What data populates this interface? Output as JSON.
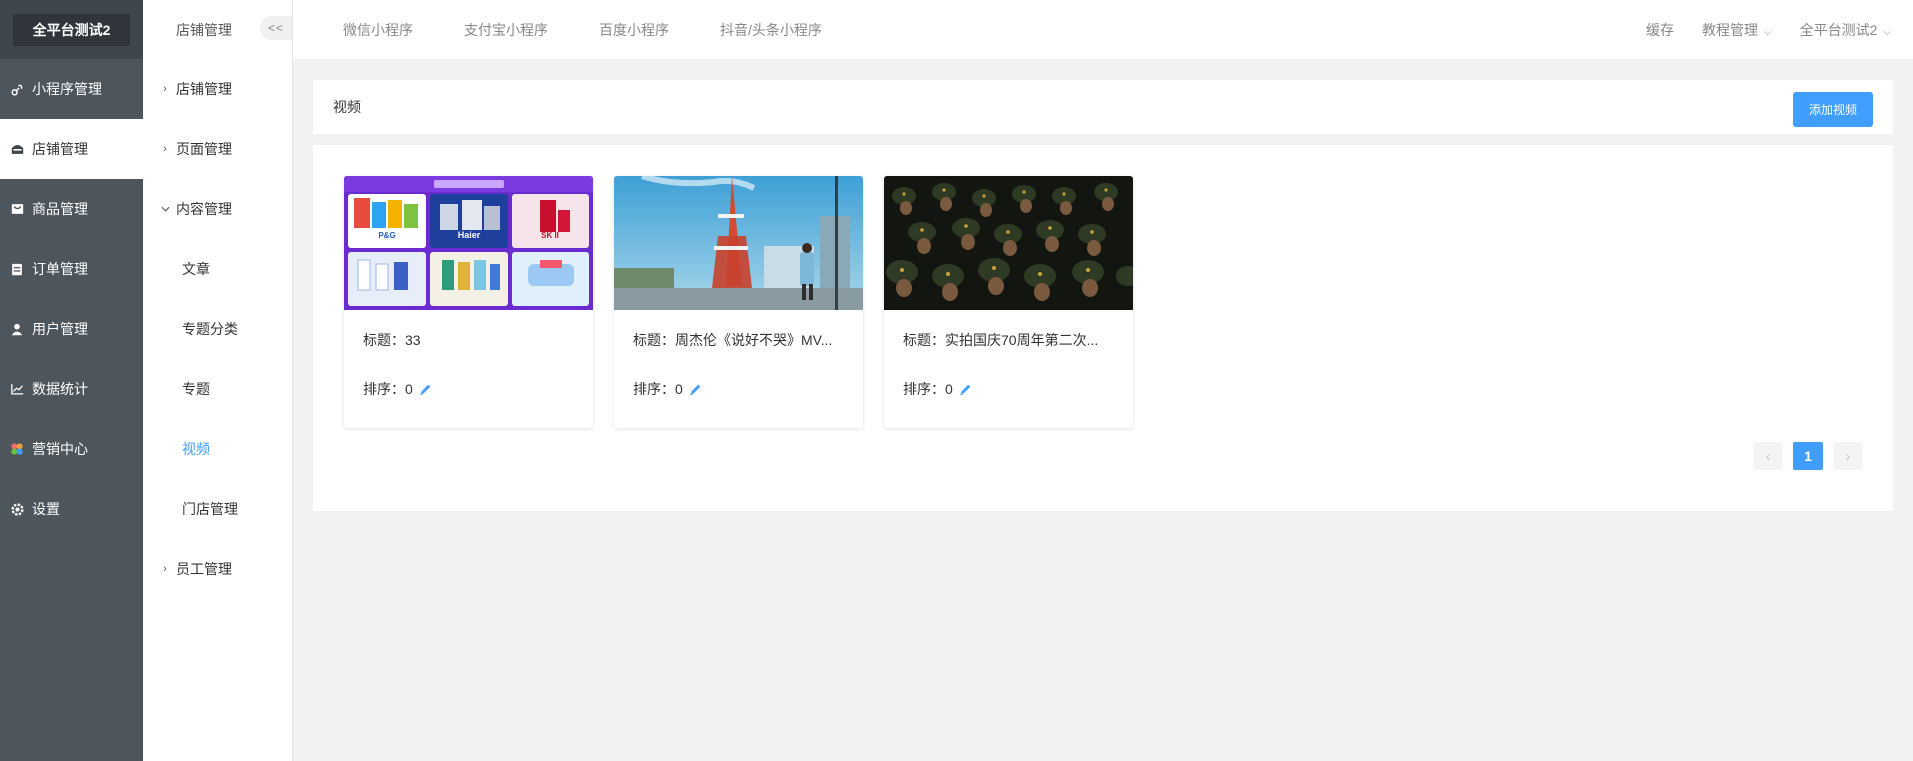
{
  "brand": "全平台测试2",
  "sidebar": {
    "items": [
      {
        "label": "小程序管理",
        "icon": "link-icon"
      },
      {
        "label": "店铺管理",
        "icon": "store-icon"
      },
      {
        "label": "商品管理",
        "icon": "goods-icon"
      },
      {
        "label": "订单管理",
        "icon": "order-icon"
      },
      {
        "label": "用户管理",
        "icon": "user-icon"
      },
      {
        "label": "数据统计",
        "icon": "chart-icon"
      },
      {
        "label": "营销中心",
        "icon": "marketing-icon"
      },
      {
        "label": "设置",
        "icon": "gear-icon"
      }
    ]
  },
  "subnav": {
    "title": "店铺管理",
    "collapse": "<<",
    "items": [
      {
        "label": "店铺管理"
      },
      {
        "label": "页面管理"
      },
      {
        "label": "内容管理"
      },
      {
        "label": "文章"
      },
      {
        "label": "专题分类"
      },
      {
        "label": "专题"
      },
      {
        "label": "视频"
      },
      {
        "label": "门店管理"
      },
      {
        "label": "员工管理"
      }
    ]
  },
  "topbar": {
    "tabs": [
      "微信小程序",
      "支付宝小程序",
      "百度小程序",
      "抖音/头条小程序"
    ],
    "cache": "缓存",
    "tutorial": "教程管理",
    "account": "全平台测试2"
  },
  "page": {
    "title": "视频",
    "add_button": "添加视频"
  },
  "videos": [
    {
      "title": "标题：33",
      "sort": "排序：0"
    },
    {
      "title": "标题：周杰伦《说好不哭》MV...",
      "sort": "排序：0"
    },
    {
      "title": "标题：实拍国庆70周年第二次...",
      "sort": "排序：0"
    }
  ],
  "pagination": {
    "prev": "‹",
    "current": "1",
    "next": "›"
  },
  "colors": {
    "accent": "#409eff",
    "sidebar": "#4d555d"
  }
}
